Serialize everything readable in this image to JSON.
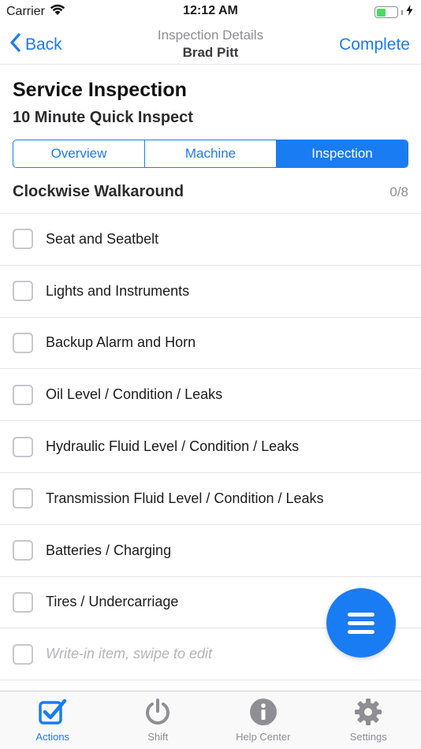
{
  "status_bar": {
    "carrier": "Carrier",
    "time": "12:12 AM",
    "battery_level": 0.45,
    "icons": [
      "wifi-icon",
      "battery-icon",
      "charging-bolt-icon"
    ]
  },
  "nav": {
    "back_label": "Back",
    "subtitle": "Inspection Details",
    "title": "Brad Pitt",
    "complete_label": "Complete"
  },
  "page": {
    "title": "Service Inspection",
    "subtitle": "10 Minute Quick Inspect"
  },
  "tabs_segment": [
    {
      "label": "Overview",
      "active": false
    },
    {
      "label": "Machine",
      "active": false
    },
    {
      "label": "Inspection",
      "active": true
    }
  ],
  "section": {
    "title": "Clockwise Walkaround",
    "count": "0/8"
  },
  "checklist": [
    {
      "label": "Seat and Seatbelt",
      "checked": false
    },
    {
      "label": "Lights and Instruments",
      "checked": false
    },
    {
      "label": "Backup Alarm and Horn",
      "checked": false
    },
    {
      "label": "Oil Level / Condition / Leaks",
      "checked": false
    },
    {
      "label": "Hydraulic Fluid Level / Condition / Leaks",
      "checked": false
    },
    {
      "label": "Transmission Fluid Level / Condition / Leaks",
      "checked": false
    },
    {
      "label": "Batteries / Charging",
      "checked": false
    },
    {
      "label": "Tires / Undercarriage",
      "checked": false
    }
  ],
  "write_in_placeholder": "Write-in item, swipe to edit",
  "fab": {
    "icon": "menu-icon"
  },
  "tab_bar": [
    {
      "label": "Actions",
      "icon": "checkbox-check-icon",
      "active": true
    },
    {
      "label": "Shift",
      "icon": "power-icon",
      "active": false
    },
    {
      "label": "Help Center",
      "icon": "info-icon",
      "active": false
    },
    {
      "label": "Settings",
      "icon": "gear-icon",
      "active": false
    }
  ],
  "colors": {
    "accent": "#1a7cf2",
    "inactive": "#8e8e93",
    "battery": "#4cd964"
  }
}
